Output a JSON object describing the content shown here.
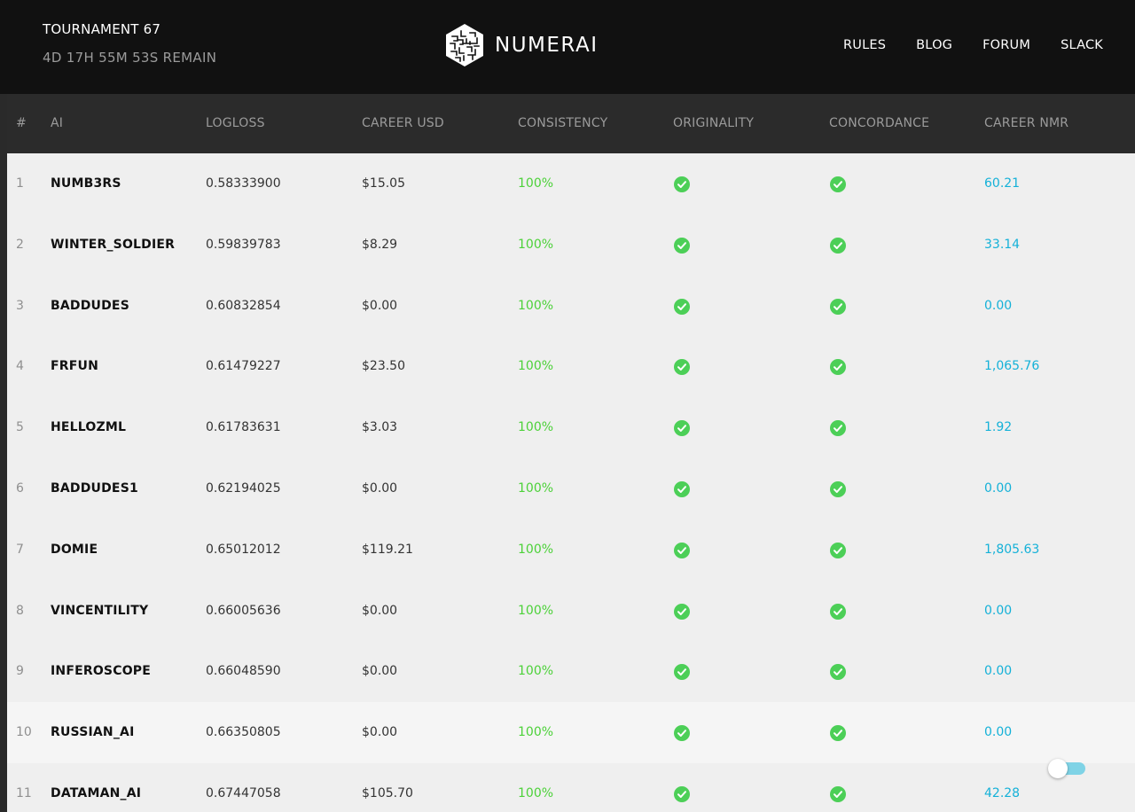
{
  "header": {
    "tournament_title": "TOURNAMENT 67",
    "time_remaining": "4D 17H 55M 53S REMAIN",
    "logo_text": "NUMERAI",
    "nav": [
      {
        "label": "RULES"
      },
      {
        "label": "BLOG"
      },
      {
        "label": "FORUM"
      },
      {
        "label": "SLACK"
      }
    ]
  },
  "table": {
    "columns": [
      "#",
      "AI",
      "LOGLOSS",
      "CAREER USD",
      "CONSISTENCY",
      "ORIGINALITY",
      "CONCORDANCE",
      "CAREER NMR"
    ],
    "rows": [
      {
        "rank": "1",
        "ai": "NUMB3RS",
        "logloss": "0.58333900",
        "career_usd": "$15.05",
        "consistency": "100%",
        "originality": true,
        "concordance": true,
        "career_nmr": "60.21"
      },
      {
        "rank": "2",
        "ai": "WINTER_SOLDIER",
        "logloss": "0.59839783",
        "career_usd": "$8.29",
        "consistency": "100%",
        "originality": true,
        "concordance": true,
        "career_nmr": "33.14"
      },
      {
        "rank": "3",
        "ai": "BADDUDES",
        "logloss": "0.60832854",
        "career_usd": "$0.00",
        "consistency": "100%",
        "originality": true,
        "concordance": true,
        "career_nmr": "0.00"
      },
      {
        "rank": "4",
        "ai": "FRFUN",
        "logloss": "0.61479227",
        "career_usd": "$23.50",
        "consistency": "100%",
        "originality": true,
        "concordance": true,
        "career_nmr": "1,065.76"
      },
      {
        "rank": "5",
        "ai": "HELLOZML",
        "logloss": "0.61783631",
        "career_usd": "$3.03",
        "consistency": "100%",
        "originality": true,
        "concordance": true,
        "career_nmr": "1.92"
      },
      {
        "rank": "6",
        "ai": "BADDUDES1",
        "logloss": "0.62194025",
        "career_usd": "$0.00",
        "consistency": "100%",
        "originality": true,
        "concordance": true,
        "career_nmr": "0.00"
      },
      {
        "rank": "7",
        "ai": "DOMIE",
        "logloss": "0.65012012",
        "career_usd": "$119.21",
        "consistency": "100%",
        "originality": true,
        "concordance": true,
        "career_nmr": "1,805.63"
      },
      {
        "rank": "8",
        "ai": "VINCENTILITY",
        "logloss": "0.66005636",
        "career_usd": "$0.00",
        "consistency": "100%",
        "originality": true,
        "concordance": true,
        "career_nmr": "0.00"
      },
      {
        "rank": "9",
        "ai": "INFEROSCOPE",
        "logloss": "0.66048590",
        "career_usd": "$0.00",
        "consistency": "100%",
        "originality": true,
        "concordance": true,
        "career_nmr": "0.00"
      },
      {
        "rank": "10",
        "ai": "RUSSIAN_AI",
        "logloss": "0.66350805",
        "career_usd": "$0.00",
        "consistency": "100%",
        "originality": true,
        "concordance": true,
        "career_nmr": "0.00"
      },
      {
        "rank": "11",
        "ai": "DATAMAN_AI",
        "logloss": "0.67447058",
        "career_usd": "$105.70",
        "consistency": "100%",
        "originality": true,
        "concordance": true,
        "career_nmr": "42.28"
      }
    ]
  },
  "colors": {
    "consistency": "#4cd139",
    "career_nmr": "#14b1d8",
    "check": "#4ccf57",
    "toggle_track": "#7fd3e6"
  },
  "toggle": {
    "state": "on"
  }
}
